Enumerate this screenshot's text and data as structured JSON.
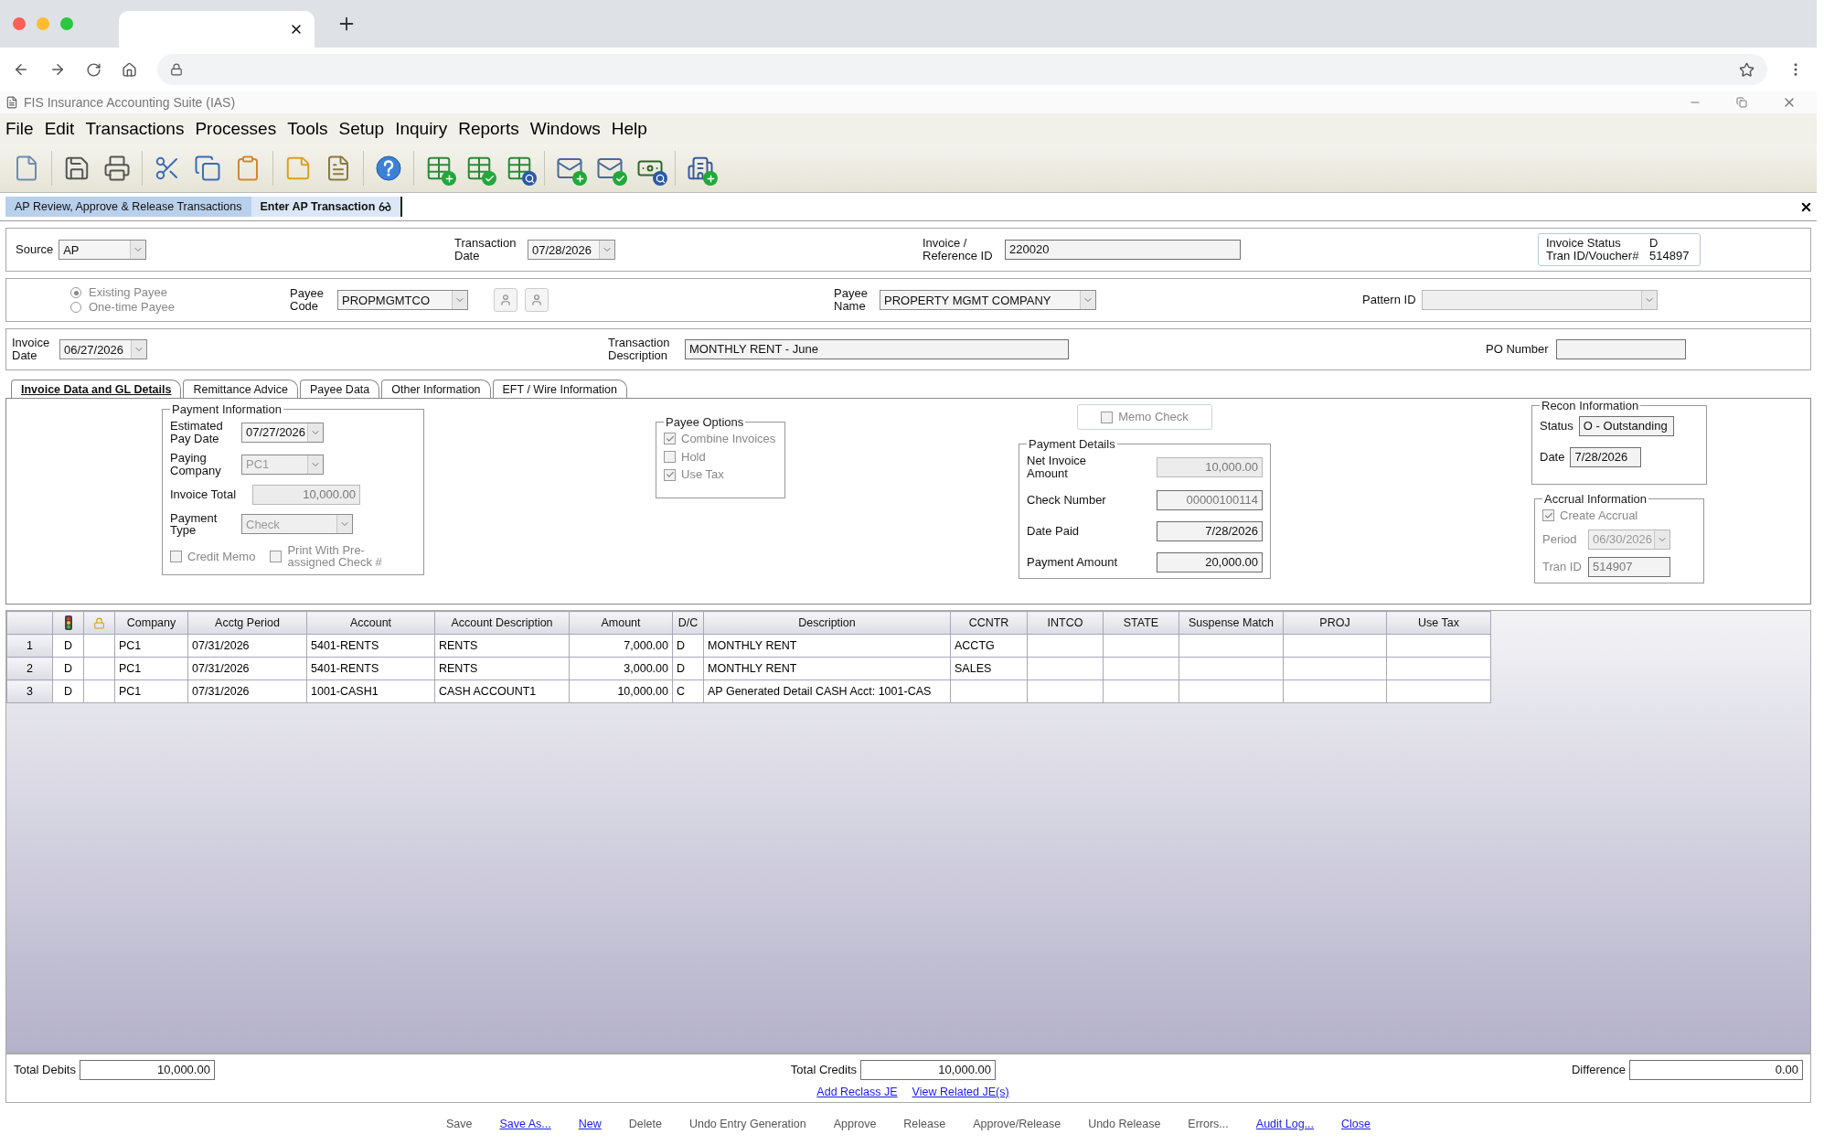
{
  "app": {
    "title": "FIS Insurance Accounting Suite (IAS)"
  },
  "menu": [
    "File",
    "Edit",
    "Transactions",
    "Processes",
    "Tools",
    "Setup",
    "Inquiry",
    "Reports",
    "Windows",
    "Help"
  ],
  "toolbar": [
    {
      "kind": "page"
    },
    {
      "kind": "separator"
    },
    {
      "kind": "floppy"
    },
    {
      "kind": "printer"
    },
    {
      "kind": "separator"
    },
    {
      "kind": "scissors"
    },
    {
      "kind": "copy"
    },
    {
      "kind": "clipboard"
    },
    {
      "kind": "separator"
    },
    {
      "kind": "note"
    },
    {
      "kind": "page-lines"
    },
    {
      "kind": "separator"
    },
    {
      "kind": "help"
    },
    {
      "kind": "separator"
    },
    {
      "kind": "table-plus"
    },
    {
      "kind": "table-check"
    },
    {
      "kind": "table-search"
    },
    {
      "kind": "separator"
    },
    {
      "kind": "mail-plus"
    },
    {
      "kind": "mail-check"
    },
    {
      "kind": "money-search"
    },
    {
      "kind": "separator"
    },
    {
      "kind": "building-plus"
    }
  ],
  "doc_tabs": [
    {
      "label": "AP Review, Approve & Release Transactions",
      "selected": false
    },
    {
      "label": "Enter AP Transaction",
      "selected": true
    }
  ],
  "header": {
    "source": {
      "label": "Source",
      "value": "AP"
    },
    "transaction_date": {
      "label": "Transaction Date",
      "value": "07/28/2026"
    },
    "reference": {
      "label": "Invoice / Reference ID",
      "value": "220020"
    },
    "status": [
      {
        "label": "Invoice Status",
        "value": "D"
      },
      {
        "label": "Tran ID/Voucher#",
        "value": "514897"
      }
    ]
  },
  "payee": {
    "types": [
      {
        "label": "Existing Payee",
        "selected": true
      },
      {
        "label": "One-time Payee",
        "selected": false
      }
    ],
    "code": {
      "label": "Payee Code",
      "value": "PROPMGMTCO"
    },
    "name": {
      "label": "Payee Name",
      "value": "PROPERTY MGMT COMPANY"
    },
    "pattern": {
      "label": "Pattern ID"
    }
  },
  "invoice": {
    "date": {
      "label": "Invoice Date",
      "value": "06/27/2026"
    },
    "description": {
      "label": "Transaction Description",
      "value": "MONTHLY RENT - June"
    },
    "po": {
      "label": "PO Number"
    }
  },
  "tabs": [
    {
      "label": "Invoice Data and GL Details",
      "selected": true
    },
    {
      "label": "Remittance Advice",
      "selected": false
    },
    {
      "label": "Payee Data",
      "selected": false
    },
    {
      "label": "Other Information",
      "selected": false
    },
    {
      "label": "EFT / Wire Information",
      "selected": false
    }
  ],
  "payment_information": {
    "title": "Payment Information",
    "fields": [
      {
        "label": "Estimated Pay Date",
        "value": "07/27/2026",
        "kind": "dropdown",
        "disabled": false
      },
      {
        "label": "Paying Company",
        "value": "PC1",
        "kind": "dropdown",
        "disabled": true
      },
      {
        "label": "Invoice Total",
        "value": "10,000.00",
        "kind": "number",
        "disabled": true
      },
      {
        "label": "Payment Type",
        "value": "Check",
        "kind": "dropdown",
        "disabled": true
      }
    ],
    "options": [
      {
        "label": "Credit Memo",
        "checked": false
      },
      {
        "label": "Print With Pre-assigned Check #",
        "checked": false
      }
    ]
  },
  "payee_options": {
    "title": "Payee Options",
    "items": [
      {
        "label": "Combine Invoices",
        "checked": true
      },
      {
        "label": "Hold",
        "checked": false
      },
      {
        "label": "Use Tax",
        "checked": true
      }
    ]
  },
  "memo_check": {
    "label": "Memo Check",
    "checked": false
  },
  "payment_details": {
    "title": "Payment Details",
    "fields": [
      {
        "label": "Net Invoice Amount",
        "value": "10,000.00",
        "disabled": true
      },
      {
        "label": "Check Number",
        "value": "00000100114",
        "disabled": true
      },
      {
        "label": "Date Paid",
        "value": "7/28/2026",
        "disabled": false
      },
      {
        "label": "Payment Amount",
        "value": "20,000.00",
        "disabled": false
      }
    ]
  },
  "recon": {
    "title": "Recon Information",
    "fields": [
      {
        "label": "Status",
        "value": "O - Outstanding"
      },
      {
        "label": "Date",
        "value": "7/28/2026"
      }
    ]
  },
  "accrual": {
    "title": "Accrual Information",
    "create": {
      "label": "Create Accrual",
      "checked": true
    },
    "fields": [
      {
        "label": "Period",
        "value": "06/30/2026",
        "kind": "dropdown"
      },
      {
        "label": "Tran ID",
        "value": "514907",
        "kind": "text"
      }
    ]
  },
  "grid": {
    "columns": [
      {
        "kind": "traffic-light"
      },
      {
        "kind": "lock"
      },
      {
        "kind": "text",
        "label": "Company"
      },
      {
        "kind": "text",
        "label": "Acctg Period"
      },
      {
        "kind": "text",
        "label": "Account"
      },
      {
        "kind": "text",
        "label": "Account Description"
      },
      {
        "kind": "number",
        "label": "Amount"
      },
      {
        "kind": "text",
        "label": "D/C"
      },
      {
        "kind": "text",
        "label": "Description"
      },
      {
        "kind": "text",
        "label": "CCNTR"
      },
      {
        "kind": "text",
        "label": "INTCO"
      },
      {
        "kind": "text",
        "label": "STATE"
      },
      {
        "kind": "text",
        "label": "Suspense Match"
      },
      {
        "kind": "text",
        "label": "PROJ"
      },
      {
        "kind": "text",
        "label": "Use Tax"
      }
    ],
    "rows": [
      {
        "number": "1",
        "cells": [
          "D",
          null,
          "PC1",
          "07/31/2026",
          "5401-RENTS",
          "RENTS",
          "7,000.00",
          "D",
          "MONTHLY RENT",
          "ACCTG",
          null,
          null,
          null,
          null,
          null
        ]
      },
      {
        "number": "2",
        "cells": [
          "D",
          null,
          "PC1",
          "07/31/2026",
          "5401-RENTS",
          "RENTS",
          "3,000.00",
          "D",
          "MONTHLY RENT",
          "SALES",
          null,
          null,
          null,
          null,
          null
        ]
      },
      {
        "number": "3",
        "cells": [
          "D",
          null,
          "PC1",
          "07/31/2026",
          "1001-CASH1",
          "CASH ACCOUNT1",
          "10,000.00",
          "C",
          "AP Generated Detail CASH Acct: 1001-CAS",
          null,
          null,
          null,
          null,
          null,
          null
        ]
      }
    ]
  },
  "totals": [
    {
      "label": "Total Debits",
      "value": "10,000.00"
    },
    {
      "label": "Total Credits",
      "value": "10,000.00"
    },
    {
      "label": "Difference",
      "value": "0.00"
    }
  ],
  "links": [
    "Add Reclass JE",
    "View Related JE(s)"
  ],
  "actions": [
    {
      "label": "Save",
      "kind": "button"
    },
    {
      "label": "Save As...",
      "kind": "link"
    },
    {
      "label": "New",
      "kind": "link"
    },
    {
      "label": "Delete",
      "kind": "button"
    },
    {
      "label": "Undo Entry Generation",
      "kind": "button"
    },
    {
      "label": "Approve",
      "kind": "button"
    },
    {
      "label": "Release",
      "kind": "button"
    },
    {
      "label": "Approve/Release",
      "kind": "button"
    },
    {
      "label": "Undo Release",
      "kind": "button"
    },
    {
      "label": "Errors...",
      "kind": "button"
    },
    {
      "label": "Audit Log...",
      "kind": "link"
    },
    {
      "label": "Close",
      "kind": "link"
    }
  ]
}
